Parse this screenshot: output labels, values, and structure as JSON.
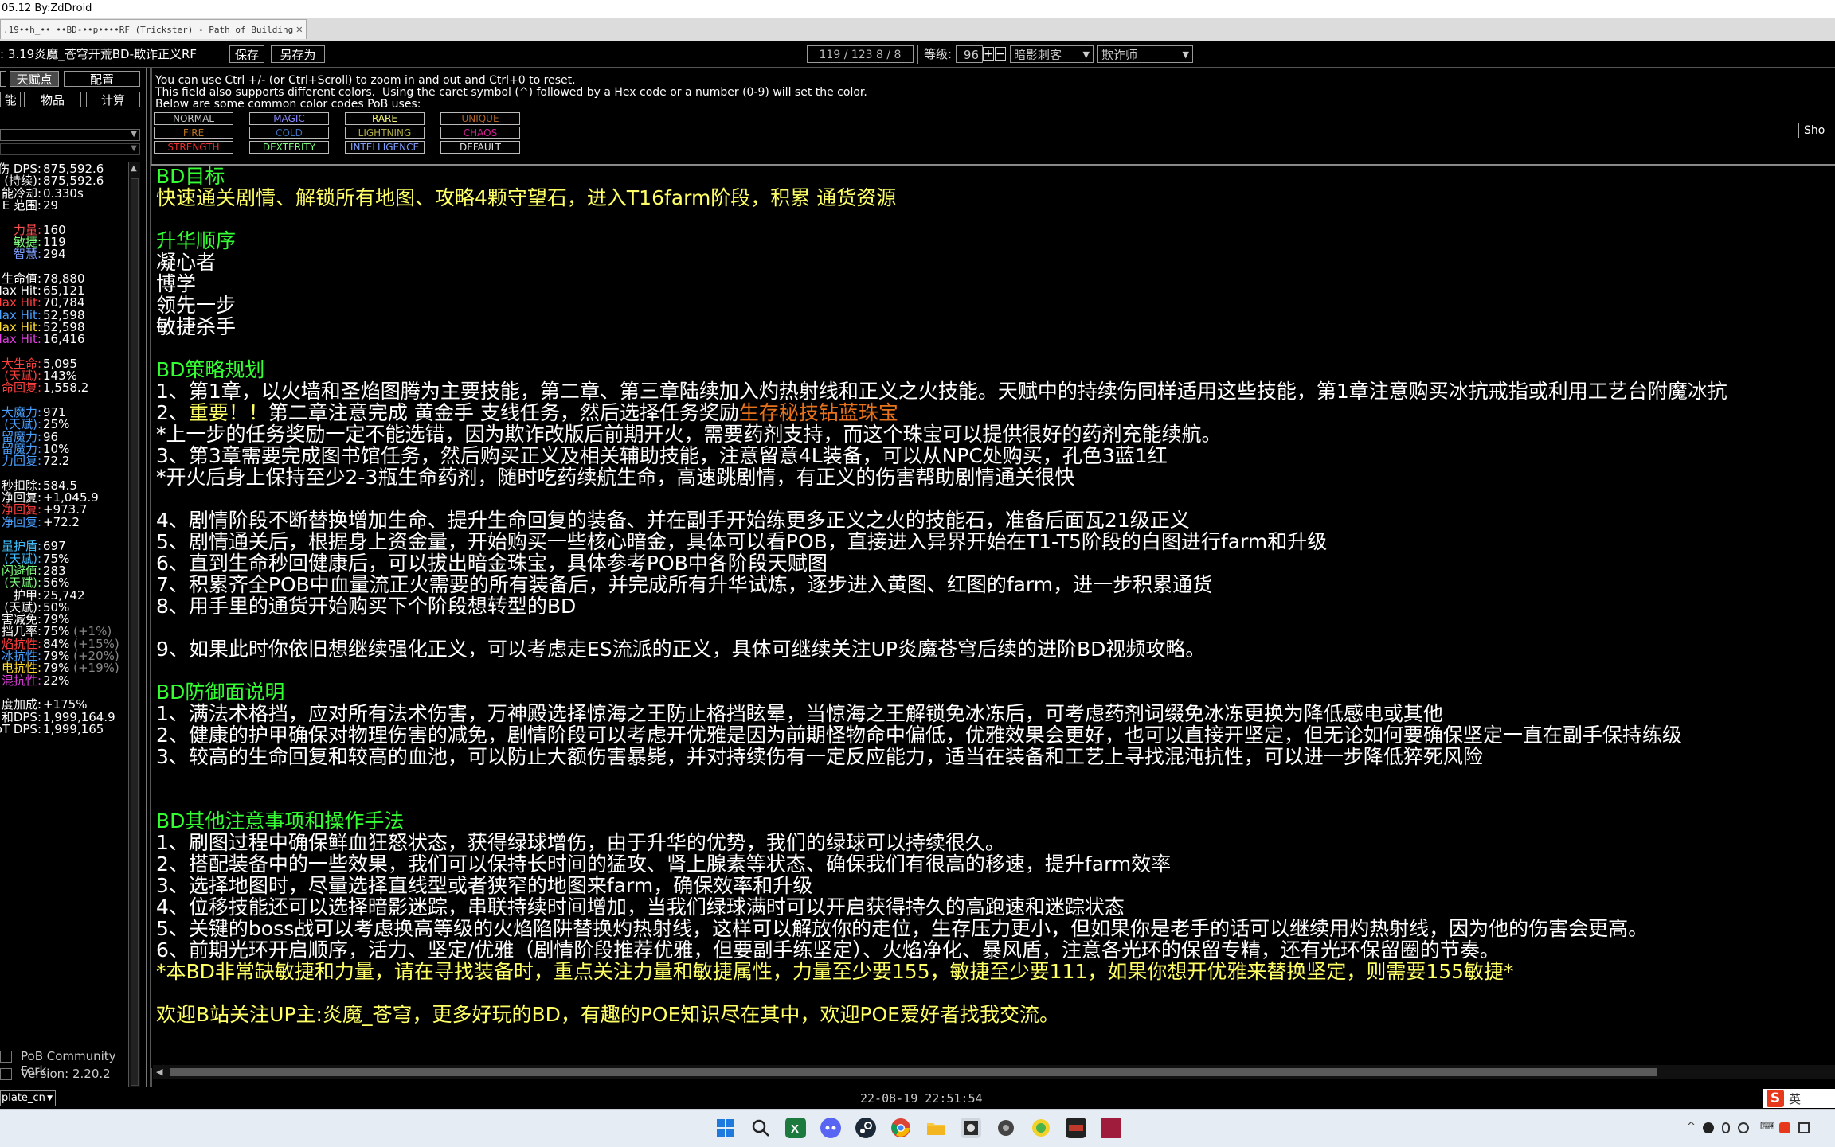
{
  "top_strip": "05.12 By:ZdDroid",
  "tab_title": ".19••h_•• ••BD-••p••••RF (Trickster) - Path of Building",
  "toolbar": {
    "build_name": "3.19炎魔_苍穹开荒BD-欺诈正义RF",
    "save": "保存",
    "save_as": "另存为",
    "points": "119 / 123  8 / 8",
    "level_label": "等级:",
    "level_value": "96",
    "plus": "+",
    "minus": "−",
    "class_value": "暗影刺客",
    "ascendancy_value": "欺诈师"
  },
  "left_tabs": {
    "tree": "天赋点",
    "config": "配置",
    "items": "物品",
    "calcs": "计算",
    "skills_partial": "能"
  },
  "stats": [
    {
      "label": "伤 DPS:",
      "value": "875,592.6",
      "color": "#ffffff"
    },
    {
      "label": "(持续):",
      "value": "875,592.6",
      "color": "#ffffff"
    },
    {
      "label": "能冷却:",
      "value": "0.330s",
      "color": "#ffffff"
    },
    {
      "label": "E 范围:",
      "value": "29",
      "color": "#ffffff"
    },
    {
      "label": "",
      "value": "",
      "color": "#ffffff"
    },
    {
      "label": "力量:",
      "value": "160",
      "color": "#ff5050"
    },
    {
      "label": "敏捷:",
      "value": "119",
      "color": "#7fff7f"
    },
    {
      "label": "智慧:",
      "value": "294",
      "color": "#7f9fff"
    },
    {
      "label": "",
      "value": "",
      "color": "#ffffff"
    },
    {
      "label": "生命值:",
      "value": "78,880",
      "color": "#ffffff"
    },
    {
      "label": "Max Hit:",
      "value": "65,121",
      "color": "#ffffff"
    },
    {
      "label": "Max Hit:",
      "value": "70,784",
      "color": "#ff4040"
    },
    {
      "label": "Max Hit:",
      "value": "52,598",
      "color": "#4aa0ff"
    },
    {
      "label": "Max Hit:",
      "value": "52,598",
      "color": "#ffdd33"
    },
    {
      "label": "Max Hit:",
      "value": "16,416",
      "color": "#e040e0"
    },
    {
      "label": "",
      "value": "",
      "color": "#ffffff"
    },
    {
      "label": "大生命:",
      "value": "5,095",
      "color": "#ff4040"
    },
    {
      "label": "(天赋):",
      "value": "143%",
      "color": "#ff4040"
    },
    {
      "label": "命回复:",
      "value": "1,558.2",
      "color": "#ff4040"
    },
    {
      "label": "",
      "value": "",
      "color": "#ffffff"
    },
    {
      "label": "大魔力:",
      "value": "971",
      "color": "#4aa0ff"
    },
    {
      "label": "(天赋):",
      "value": "25%",
      "color": "#4aa0ff"
    },
    {
      "label": "留魔力:",
      "value": "96",
      "color": "#4aa0ff"
    },
    {
      "label": "留魔力:",
      "value": "10%",
      "color": "#4aa0ff"
    },
    {
      "label": "力回复:",
      "value": "72.2",
      "color": "#4aa0ff"
    },
    {
      "label": "",
      "value": "",
      "color": "#ffffff"
    },
    {
      "label": "秒扣除:",
      "value": "584.5",
      "color": "#ffffff"
    },
    {
      "label": "净回复:",
      "value": "+1,045.9",
      "color": "#ffffff"
    },
    {
      "label": "净回复:",
      "value": "+973.7",
      "color": "#ff4040"
    },
    {
      "label": "净回复:",
      "value": "+72.2",
      "color": "#4aa0ff"
    },
    {
      "label": "",
      "value": "",
      "color": "#ffffff"
    },
    {
      "label": "量护盾:",
      "value": "697",
      "color": "#40c0ff"
    },
    {
      "label": "(天赋):",
      "value": "75%",
      "color": "#40c0ff"
    },
    {
      "label": "闪避值:",
      "value": "283",
      "color": "#7fff7f"
    },
    {
      "label": "(天赋):",
      "value": "56%",
      "color": "#7fff7f"
    },
    {
      "label": "护甲:",
      "value": "25,742",
      "color": "#ffffff"
    },
    {
      "label": "(天赋):",
      "value": "50%",
      "color": "#ffffff"
    },
    {
      "label": "害减免:",
      "value": "79%",
      "color": "#ffffff"
    },
    {
      "label": "挡几率:",
      "value": "75% (+1%)",
      "color": "#ffffff"
    },
    {
      "label": "焰抗性:",
      "value": "84% (+15%)",
      "color": "#ff4040"
    },
    {
      "label": "冰抗性:",
      "value": "79% (+20%)",
      "color": "#4aa0ff"
    },
    {
      "label": "电抗性:",
      "value": "79% (+19%)",
      "color": "#ffdd33"
    },
    {
      "label": "混抗性:",
      "value": "22%",
      "color": "#e040e0"
    },
    {
      "label": "",
      "value": "",
      "color": "#ffffff"
    },
    {
      "label": "度加成:",
      "value": "+175%",
      "color": "#ffffff"
    },
    {
      "label": "和DPS:",
      "value": "1,999,164.9",
      "color": "#ffffff"
    },
    {
      "label": "oT DPS:",
      "value": "1,999,165",
      "color": "#ffffff"
    }
  ],
  "footer": {
    "fork": "PoB Community Fork",
    "version": "Version: 2.20.2",
    "locale": "plate_cn",
    "timestamp": "22-08-19 22:51:54"
  },
  "info_text": "You can use Ctrl +/- (or Ctrl+Scroll) to zoom in and out and Ctrl+0 to reset.\nThis field also supports different colors.  Using the caret symbol (^) followed by a Hex code or a number (0-9) will set the color.\nBelow are some common color codes PoB uses:",
  "color_codes": [
    {
      "name": "NORMAL",
      "color": "#c8c8c8"
    },
    {
      "name": "MAGIC",
      "color": "#8888ff"
    },
    {
      "name": "RARE",
      "color": "#ffff77"
    },
    {
      "name": "UNIQUE",
      "color": "#af6025"
    },
    {
      "name": "FIRE",
      "color": "#b97123"
    },
    {
      "name": "COLD",
      "color": "#3f6db3"
    },
    {
      "name": "LIGHTNING",
      "color": "#adaa47"
    },
    {
      "name": "CHAOS",
      "color": "#d02090"
    },
    {
      "name": "STRENGTH",
      "color": "#e83030"
    },
    {
      "name": "DEXTERITY",
      "color": "#7fff7f"
    },
    {
      "name": "INTELLIGENCE",
      "color": "#7f9fff"
    },
    {
      "name": "DEFAULT",
      "color": "#e0e0e0"
    }
  ],
  "show_button": "Sho",
  "colors": {
    "heading": "#33ff33",
    "highlight": "#ffff66",
    "body": "#ffffff",
    "unique": "#e8731c"
  },
  "notes_lines": [
    {
      "t": "BD目标",
      "c": "#33ff33"
    },
    {
      "t": "快速通关剧情、解锁所有地图、攻略4颗守望石，进入T16farm阶段，积累 通货资源",
      "c": "#ffff66"
    },
    {
      "t": "",
      "c": "#ffffff"
    },
    {
      "t": "升华顺序",
      "c": "#33ff33"
    },
    {
      "t": "凝心者",
      "c": "#ffffff"
    },
    {
      "t": "博学",
      "c": "#ffffff"
    },
    {
      "t": "领先一步",
      "c": "#ffffff"
    },
    {
      "t": "敏捷杀手",
      "c": "#ffffff"
    },
    {
      "t": "",
      "c": "#ffffff"
    },
    {
      "t": "BD策略规划",
      "c": "#33ff33"
    },
    {
      "t": "1、第1章，以火墙和圣焰图腾为主要技能，第二章、第三章陆续加入灼热射线和正义之火技能。天赋中的持续伤同样适用这些技能，第1章注意购买冰抗戒指或利用工艺台附魔冰抗",
      "c": "#ffffff"
    },
    {
      "t": "__LINE2__",
      "c": "#ffffff"
    },
    {
      "t": "*上一步的任务奖励一定不能选错，因为欺诈改版后前期开火，需要药剂支持，而这个珠宝可以提供很好的药剂充能续航。",
      "c": "#ffffff"
    },
    {
      "t": "3、第3章需要完成图书馆任务，然后购买正义及相关辅助技能，注意留意4L装备，可以从NPC处购买，孔色3蓝1红",
      "c": "#ffffff"
    },
    {
      "t": "*开火后身上保持至少2-3瓶生命药剂，随时吃药续航生命，高速跳剧情，有正义的伤害帮助剧情通关很快",
      "c": "#ffffff"
    },
    {
      "t": "",
      "c": "#ffffff"
    },
    {
      "t": "4、剧情阶段不断替换增加生命、提升生命回复的装备、并在副手开始练更多正义之火的技能石，准备后面瓦21级正义",
      "c": "#ffffff"
    },
    {
      "t": "5、剧情通关后，根据身上资金量，开始购买一些核心暗金，具体可以看POB，直接进入异界开始在T1-T5阶段的白图进行farm和升级",
      "c": "#ffffff"
    },
    {
      "t": "6、直到生命秒回健康后，可以拔出暗金珠宝，具体参考POB中各阶段天赋图",
      "c": "#ffffff"
    },
    {
      "t": "7、积累齐全POB中血量流正火需要的所有装备后，并完成所有升华试炼，逐步进入黄图、红图的farm，进一步积累通货",
      "c": "#ffffff"
    },
    {
      "t": "8、用手里的通货开始购买下个阶段想转型的BD",
      "c": "#ffffff"
    },
    {
      "t": "",
      "c": "#ffffff"
    },
    {
      "t": "9、如果此时你依旧想继续强化正义，可以考虑走ES流派的正义，具体可继续关注UP炎魔苍穹后续的进阶BD视频攻略。",
      "c": "#ffffff"
    },
    {
      "t": "",
      "c": "#ffffff"
    },
    {
      "t": "BD防御面说明",
      "c": "#33ff33"
    },
    {
      "t": "1、满法术格挡，应对所有法术伤害，万神殿选择惊海之王防止格挡眩晕，当惊海之王解锁免冰冻后，可考虑药剂词缀免冰冻更换为降低感电或其他",
      "c": "#ffffff"
    },
    {
      "t": "2、健康的护甲确保对物理伤害的减免，剧情阶段可以考虑开优雅是因为前期怪物命中偏低，优雅效果会更好，也可以直接开坚定，但无论如何要确保坚定一直在副手保持练级",
      "c": "#ffffff"
    },
    {
      "t": "3、较高的生命回复和较高的血池，可以防止大额伤害暴毙，并对持续伤有一定反应能力，适当在装备和工艺上寻找混沌抗性，可以进一步降低猝死风险",
      "c": "#ffffff"
    },
    {
      "t": "",
      "c": "#ffffff"
    },
    {
      "t": "",
      "c": "#ffffff"
    },
    {
      "t": "BD其他注意事项和操作手法",
      "c": "#33ff33"
    },
    {
      "t": "1、刷图过程中确保鲜血狂怒状态，获得绿球增伤，由于升华的优势，我们的绿球可以持续很久。",
      "c": "#ffffff"
    },
    {
      "t": "2、搭配装备中的一些效果，我们可以保持长时间的猛攻、肾上腺素等状态、确保我们有很高的移速，提升farm效率",
      "c": "#ffffff"
    },
    {
      "t": "3、选择地图时，尽量选择直线型或者狭窄的地图来farm，确保效率和升级",
      "c": "#ffffff"
    },
    {
      "t": "4、位移技能还可以选择暗影迷踪，串联持续时间增加，当我们绿球满时可以开启获得持久的高跑速和迷踪状态",
      "c": "#ffffff"
    },
    {
      "t": "5、关键的boss战可以考虑换高等级的火焰陷阱替换灼热射线，这样可以解放你的走位，生存压力更小，但如果你是老手的话可以继续用灼热射线，因为他的伤害会更高。",
      "c": "#ffffff"
    },
    {
      "t": "6、前期光环开启顺序，活力、坚定/优雅（剧情阶段推荐优雅，但要副手练坚定）、火焰净化、暴风盾，注意各光环的保留专精，还有光环保留圈的节奏。",
      "c": "#ffffff"
    },
    {
      "t": "*本BD非常缺敏捷和力量，请在寻找装备时，重点关注力量和敏捷属性，力量至少要155，敏捷至少要111，如果你想开优雅来替换坚定，则需要155敏捷*",
      "c": "#ffff66"
    },
    {
      "t": "",
      "c": "#ffffff"
    },
    {
      "t": "欢迎B站关注UP主:炎魔_苍穹，更多好玩的BD，有趣的POE知识尽在其中，欢迎POE爱好者找我交流。",
      "c": "#ffff66"
    }
  ],
  "line2": {
    "prefix": "2、",
    "important": "重要！！",
    "mid": "第二章注意完成 黄金手   支线任务，然后选择任务奖励",
    "unique": "生存秘技钻蓝珠宝"
  },
  "tray": {
    "ime": "英",
    "ime_logo": "S"
  },
  "taskbar_icons": [
    "windows-icon",
    "search-icon",
    "excel-icon",
    "discord-icon",
    "steam-icon",
    "chrome-icon",
    "folder-icon",
    "pob-icon",
    "app-icon",
    "wechat-icon",
    "game-icon",
    "red-app-icon"
  ]
}
